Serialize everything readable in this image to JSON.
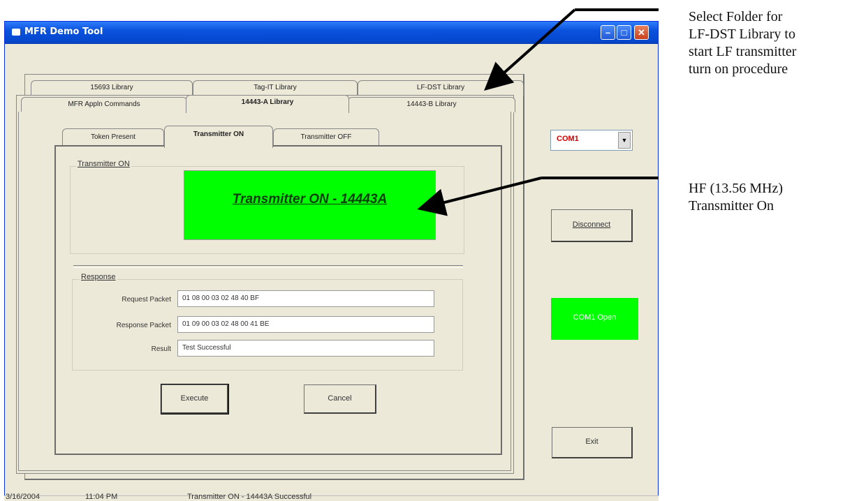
{
  "window": {
    "title": "MFR Demo Tool",
    "controls": {
      "minimize": "–",
      "maximize": "□",
      "close": "✕"
    }
  },
  "outer_tabs": {
    "back_row": [
      "15693 Library",
      "Tag-IT Library",
      "LF-DST Library"
    ],
    "front_row": [
      "MFR Appln Commands",
      "14443-A Library",
      "14443-B Library"
    ],
    "active": "14443-A Library"
  },
  "inner_tabs": {
    "items": [
      "Token Present",
      "Transmitter ON",
      "Transmitter OFF"
    ],
    "active": "Transmitter ON"
  },
  "transmitter_group": {
    "label": "Transmitter ON",
    "status_text": "Transmitter ON - 14443A",
    "status_color": "#00ff00"
  },
  "response_group": {
    "label": "Response",
    "request_label": "Request Packet",
    "request_value": "01 08 00 03 02 48 40 BF",
    "response_label": "Response Packet",
    "response_value": "01 09 00 03 02 48 00 41 BE",
    "result_label": "Result",
    "result_value": "Test Successful"
  },
  "buttons": {
    "execute": "Execute",
    "cancel": "Cancel",
    "disconnect": "Disconnect",
    "exit": "Exit"
  },
  "port": {
    "selected": "COM1",
    "status": "COM1 Open",
    "status_color": "#00ff00"
  },
  "statusbar": {
    "date": "3/16/2004",
    "time": "11:04 PM",
    "message": "Transmitter ON - 14443A Successful"
  },
  "annotations": {
    "lf_dst": [
      "Select Folder for",
      "LF-DST Library to",
      "start LF transmitter",
      "turn on procedure"
    ],
    "hf": [
      "HF (13.56 MHz)",
      "Transmitter On"
    ]
  }
}
